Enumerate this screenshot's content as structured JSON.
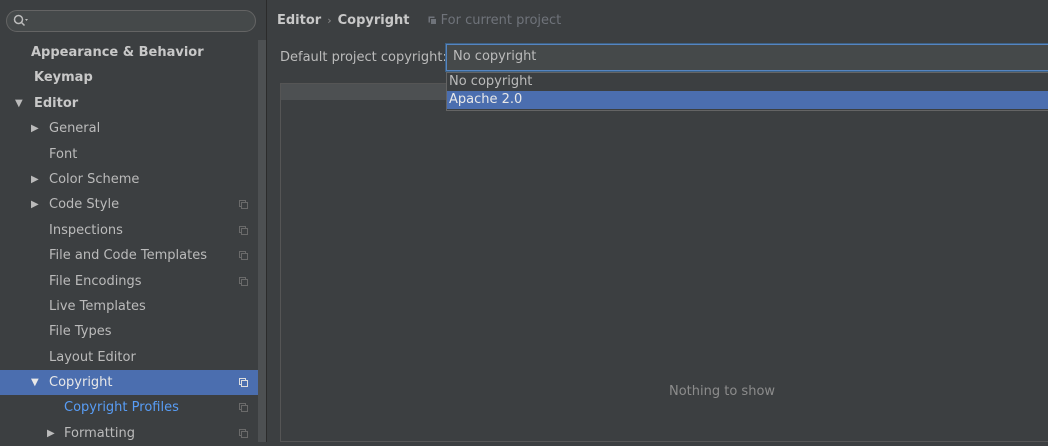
{
  "search": {
    "placeholder": ""
  },
  "tree": {
    "items": [
      {
        "label": "Appearance & Behavior"
      },
      {
        "label": "Keymap"
      },
      {
        "label": "Editor"
      },
      {
        "label": "General"
      },
      {
        "label": "Font"
      },
      {
        "label": "Color Scheme"
      },
      {
        "label": "Code Style"
      },
      {
        "label": "Inspections"
      },
      {
        "label": "File and Code Templates"
      },
      {
        "label": "File Encodings"
      },
      {
        "label": "Live Templates"
      },
      {
        "label": "File Types"
      },
      {
        "label": "Layout Editor"
      },
      {
        "label": "Copyright"
      },
      {
        "label": "Copyright Profiles"
      },
      {
        "label": "Formatting"
      }
    ]
  },
  "breadcrumb": {
    "section": "Editor",
    "page": "Copyright",
    "scope": "For current project"
  },
  "form": {
    "label": "Default project copyright:",
    "value": "No copyright",
    "options": [
      "No copyright",
      "Apache 2.0"
    ]
  },
  "empty_text": "Nothing to show",
  "colors": {
    "selection": "#4b6eaf",
    "link": "#589df6",
    "background": "#3c3f41"
  }
}
